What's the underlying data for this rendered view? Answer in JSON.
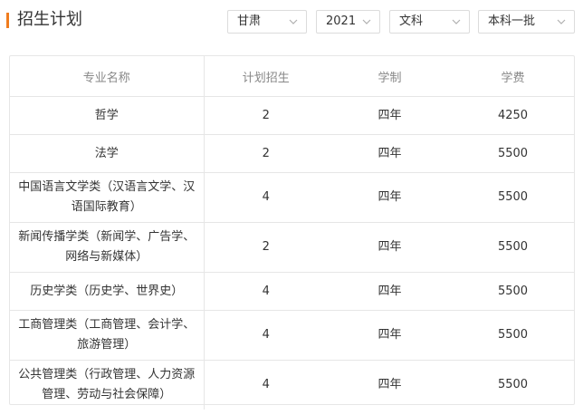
{
  "header": {
    "title": "招生计划",
    "accent_color": "#f07c1e",
    "filters": [
      {
        "value": "甘肃",
        "icon": "chevron-down-icon"
      },
      {
        "value": "2021",
        "icon": "chevron-down-icon"
      },
      {
        "value": "文科",
        "icon": "chevron-down-icon"
      },
      {
        "value": "本科一批",
        "icon": "chevron-down-icon"
      }
    ]
  },
  "table": {
    "columns": [
      "专业名称",
      "计划招生",
      "学制",
      "学费"
    ],
    "rows": [
      {
        "major": "哲学",
        "plan": "2",
        "years": "四年",
        "fee": "4250"
      },
      {
        "major": "法学",
        "plan": "2",
        "years": "四年",
        "fee": "5500"
      },
      {
        "major": "中国语言文学类（汉语言文学、汉语国际教育）",
        "plan": "4",
        "years": "四年",
        "fee": "5500"
      },
      {
        "major": "新闻传播学类（新闻学、广告学、网络与新媒体）",
        "plan": "2",
        "years": "四年",
        "fee": "5500"
      },
      {
        "major": "历史学类（历史学、世界史）",
        "plan": "4",
        "years": "四年",
        "fee": "5500"
      },
      {
        "major": "工商管理类（工商管理、会计学、旅游管理）",
        "plan": "4",
        "years": "四年",
        "fee": "5500"
      },
      {
        "major": "公共管理类（行政管理、人力资源管理、劳动与社会保障）",
        "plan": "4",
        "years": "四年",
        "fee": "5500"
      }
    ]
  }
}
